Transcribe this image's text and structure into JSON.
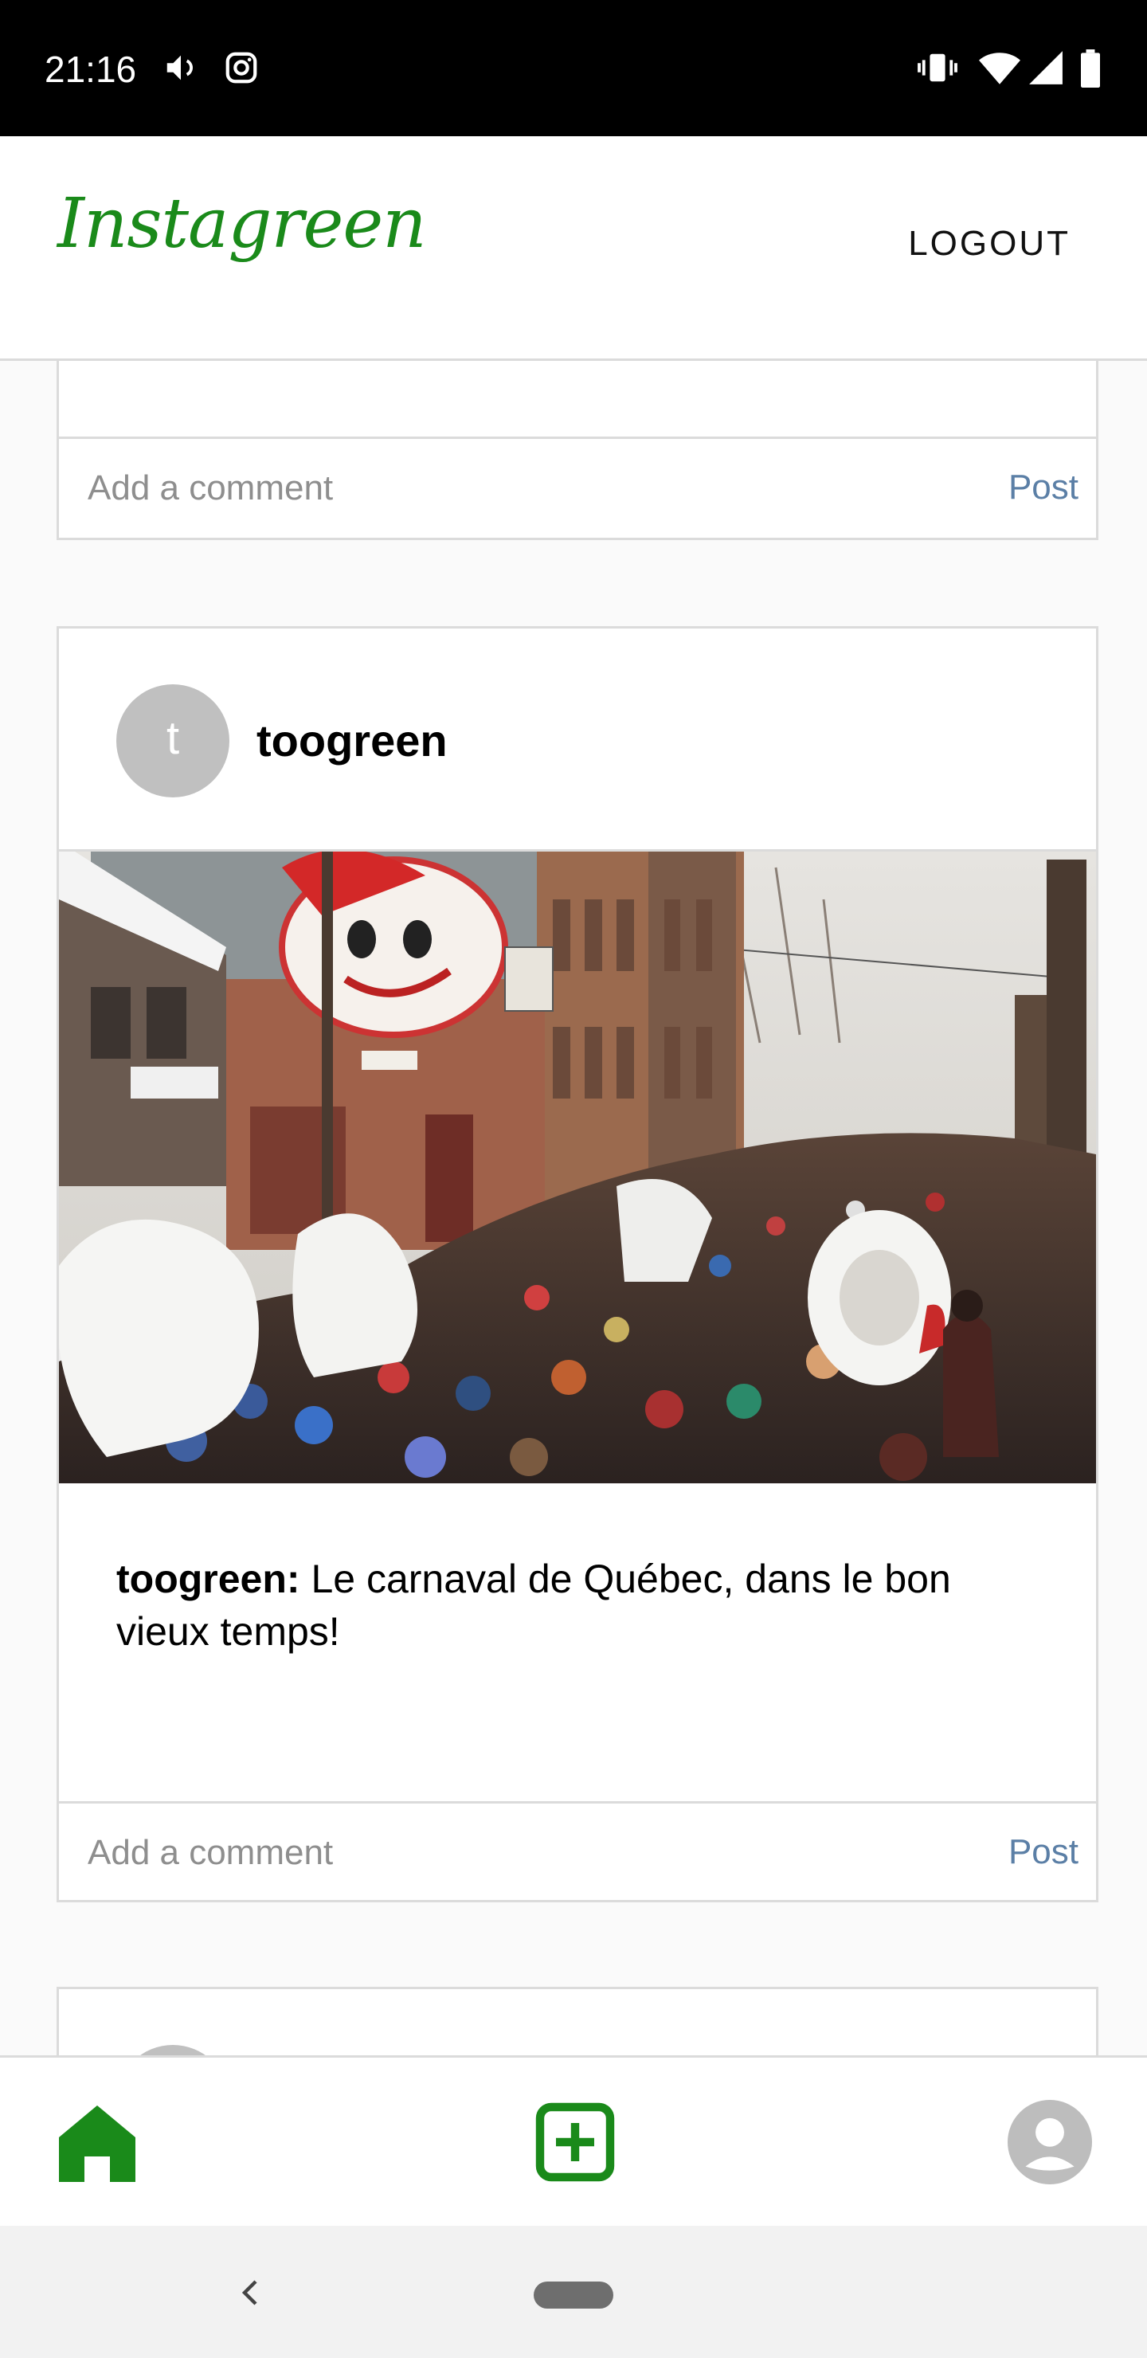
{
  "status_bar": {
    "time": "21:16",
    "left_icons": [
      "volume-icon",
      "instagram-icon"
    ],
    "right_icons": [
      "vibrate-icon",
      "wifi-icon",
      "signal-icon",
      "battery-icon"
    ]
  },
  "header": {
    "logo": "Instagreen",
    "logout_label": "LOGOUT"
  },
  "colors": {
    "brand_green": "#1a8a1a",
    "post_blue": "#5b7fa6",
    "border": "#dbdbdb"
  },
  "feed": {
    "prev_post": {
      "comment_placeholder": "Add a comment",
      "post_label": "Post"
    },
    "post": {
      "avatar_initial": "t",
      "username": "toogreen",
      "photo_icon": "photo-winter-carnival",
      "caption_user": "toogreen:",
      "caption_text": " Le carnaval de Québec, dans le bon vieux temps!",
      "comment_placeholder": "Add a comment",
      "post_label": "Post"
    }
  },
  "bottom_nav": {
    "items": [
      "home-icon",
      "add-post-icon",
      "profile-icon"
    ]
  },
  "system_nav": {
    "items": [
      "back-icon",
      "home-pill"
    ]
  }
}
